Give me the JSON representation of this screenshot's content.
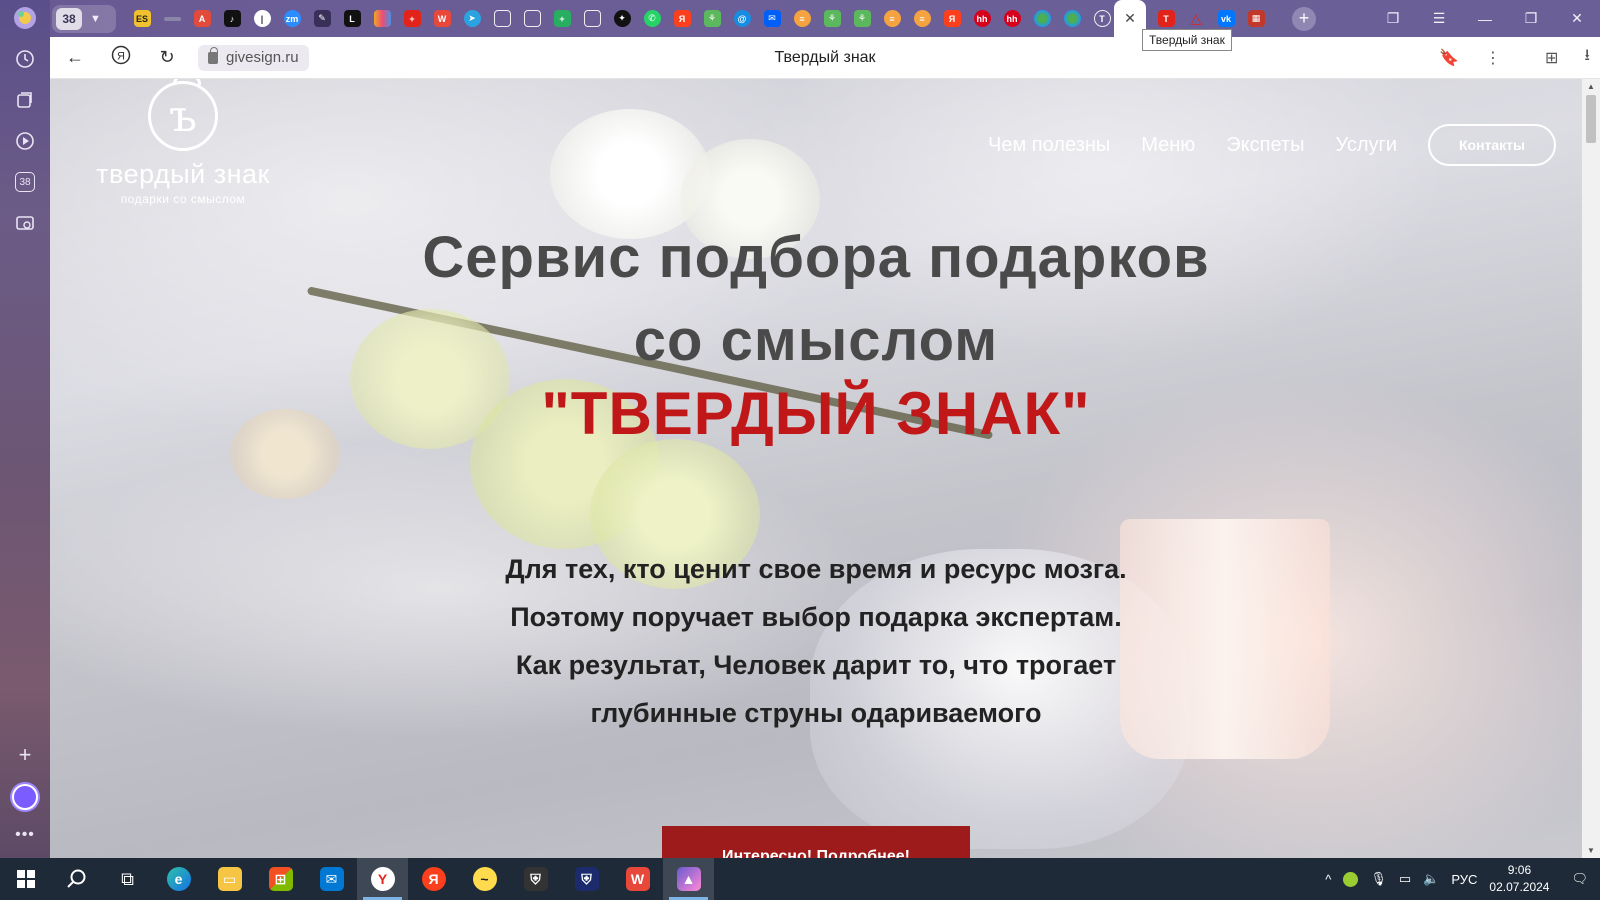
{
  "browser": {
    "tab_count": "38",
    "active_tab_title": "Твердый знак",
    "tooltip": "Твердый знак",
    "url": "givesign.ru",
    "page_title": "Твердый знак",
    "sidebar_badge": "38"
  },
  "site": {
    "logo_mark": "ъ",
    "logo_name": "твердый знак",
    "logo_tagline": "подарки со смыслом",
    "nav": [
      "Чем полезны",
      "Меню",
      "Экспеты",
      "Услуги"
    ],
    "contact_button": "Контакты",
    "hero_line1": "Сервис подбора подарков",
    "hero_line2": "со смыслом",
    "hero_brand": "\"ТВЕРДЫЙ ЗНАК\"",
    "hero_text": [
      "Для тех, кто ценит свое время и ресурс мозга.",
      "Поэтому поручает выбор подарка экспертам.",
      "Как результат, Человек дарит то, что трогает",
      "глубинные струны одариваемого"
    ],
    "cta_button": "Интересно! Подробнее!",
    "accent_color": "#c01818",
    "cta_color": "#9e1b1b"
  },
  "taskbar": {
    "language": "РУС",
    "time": "9:06",
    "date": "02.07.2024"
  }
}
